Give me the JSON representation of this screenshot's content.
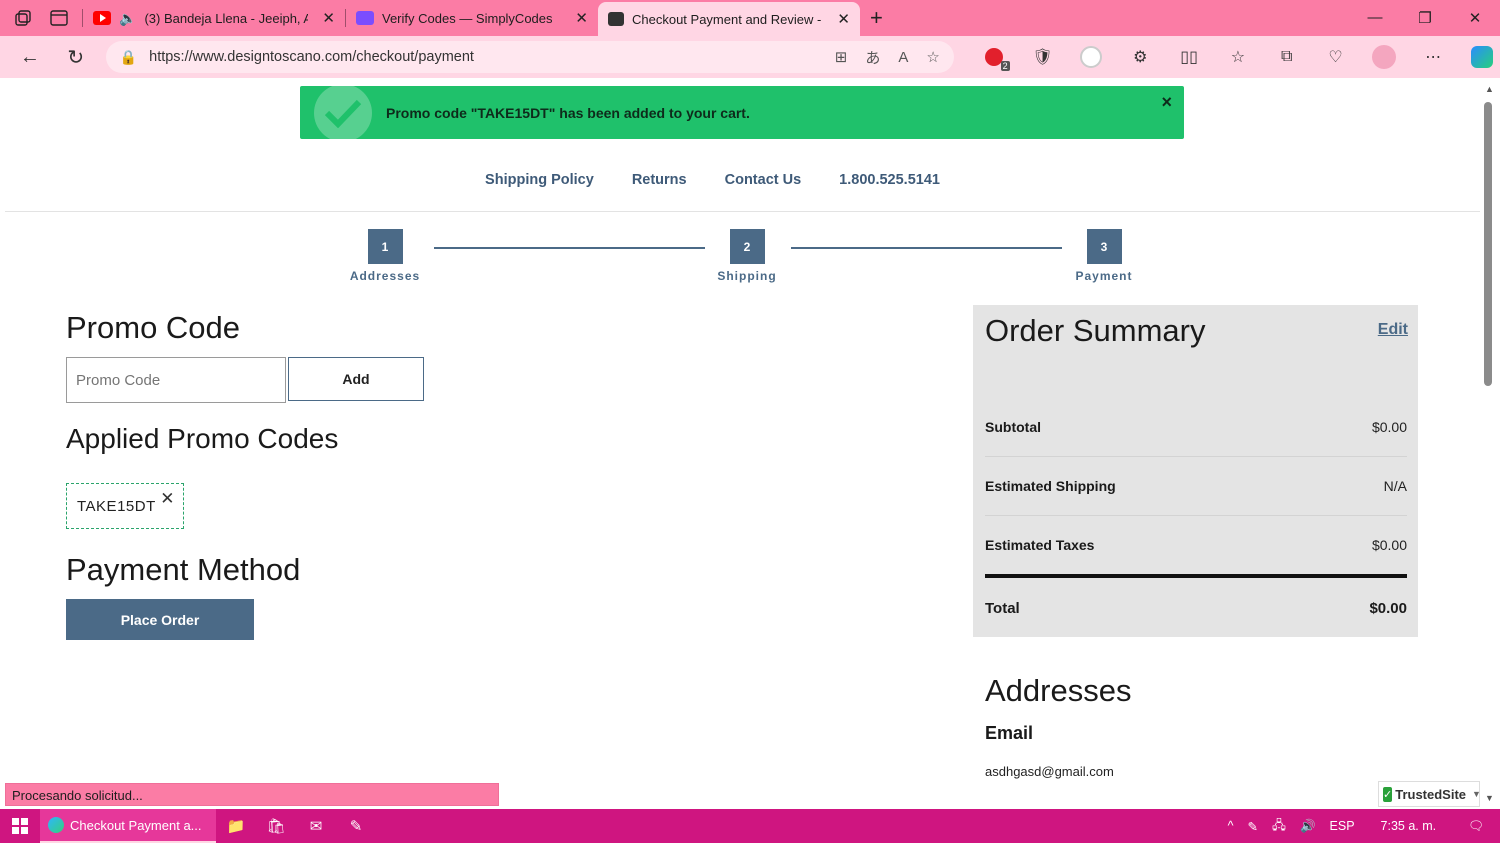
{
  "browser": {
    "tabs": [
      {
        "title": "(3) Bandeja Llena - Jeeiph, A",
        "favicon_color": "#ff0000"
      },
      {
        "title": "Verify Codes — SimplyCodes",
        "favicon_color": "#7b4dff"
      },
      {
        "title": "Checkout Payment and Review -",
        "favicon_color": "#333333",
        "active": true
      }
    ],
    "url": "https://www.designtoscano.com/checkout/payment",
    "extension_badge": "2"
  },
  "toast": {
    "message": "Promo code \"TAKE15DT\" has been added to your cart.",
    "close": "×"
  },
  "nav_links": [
    "Shipping Policy",
    "Returns",
    "Contact Us",
    "1.800.525.5141"
  ],
  "steps": [
    {
      "num": "1",
      "label": "Addresses"
    },
    {
      "num": "2",
      "label": "Shipping"
    },
    {
      "num": "3",
      "label": "Payment"
    }
  ],
  "promo": {
    "title": "Promo Code",
    "placeholder": "Promo Code",
    "add_label": "Add",
    "applied_title": "Applied Promo Codes",
    "applied_code": "TAKE15DT"
  },
  "payment": {
    "title": "Payment Method",
    "place_order": "Place Order"
  },
  "summary": {
    "title": "Order Summary",
    "edit": "Edit",
    "rows": [
      {
        "label": "Subtotal",
        "value": "$0.00"
      },
      {
        "label": "Estimated Shipping",
        "value": "N/A"
      },
      {
        "label": "Estimated Taxes",
        "value": "$0.00"
      }
    ],
    "total_label": "Total",
    "total_value": "$0.00"
  },
  "addresses": {
    "title": "Addresses",
    "email_label": "Email",
    "email_value": "asdhgasd@gmail.com"
  },
  "status_text": "Procesando solicitud...",
  "trusted_site": "TrustedSite",
  "taskbar": {
    "app_label": "Checkout Payment a...",
    "lang": "ESP",
    "time": "7:35 a. m."
  },
  "colors": {
    "accent": "#4b6a87",
    "toast": "#1fc16b",
    "browser_chrome": "#fb7ca5",
    "taskbar": "#cf1580"
  }
}
